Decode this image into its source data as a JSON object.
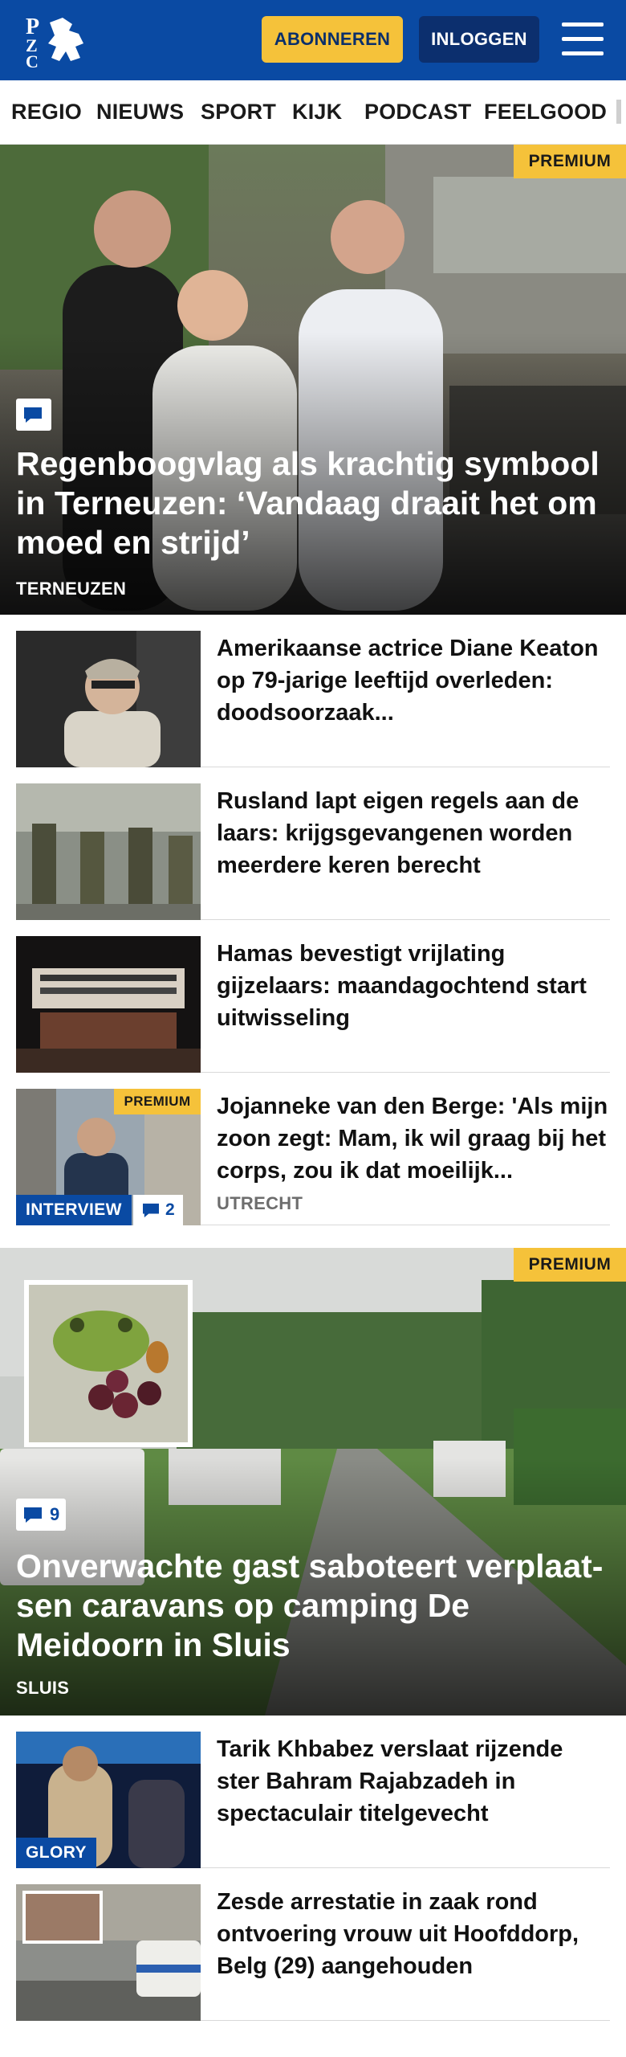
{
  "header": {
    "logo_letters": "PZC",
    "subscribe_label": "ABONNEREN",
    "login_label": "INLOGGEN",
    "menu_icon": "hamburger-menu-icon"
  },
  "nav": {
    "items": [
      "REGIO",
      "NIEUWS",
      "SPORT",
      "KIJK",
      "PODCAST",
      "FEELGOOD"
    ]
  },
  "hero1": {
    "premium": "PREMIUM",
    "title": "Regenboogvlag als krachtig symbool in Terneuzen: ‘Vandaag draait het om moed en strijd’",
    "location": "TERNEUZEN"
  },
  "articles": [
    {
      "title": "Amerikaanse actrice Diane Keaton op 79-jarige leeftijd overleden: doodsoorzaak..."
    },
    {
      "title": "Rusland lapt eigen regels aan de laars: krijgsgevangenen worden meerdere keren berecht"
    },
    {
      "title": "Hamas bevestigt vrijlating gijzelaars: maandagochtend start uitwisseling"
    },
    {
      "title": "Jojanneke van den Berge: 'Als mijn zoon zegt: Mam, ik wil graag bij het corps, zou ik dat moeilijk...",
      "location": "UTRECHT",
      "tag": "INTERVIEW",
      "comments": "2",
      "premium": "PREMIUM"
    }
  ],
  "hero2": {
    "premium": "PREMIUM",
    "comments": "9",
    "title": "Onverwachte gast saboteert verplaat­sen caravans op camping De Meidoorn in Sluis",
    "location": "SLUIS"
  },
  "articles2": [
    {
      "title": "Tarik Khbabez verslaat rijzende ster Bahram Rajabzadeh in spectaculair titelgevecht",
      "tag": "GLORY"
    },
    {
      "title": "Zesde arrestatie in zaak rond ontvoering vrouw uit Hoofddorp, Belg (29) aangehouden"
    }
  ],
  "colors": {
    "brand_blue": "#0a4aa3",
    "premium_yellow": "#f5c23a"
  }
}
